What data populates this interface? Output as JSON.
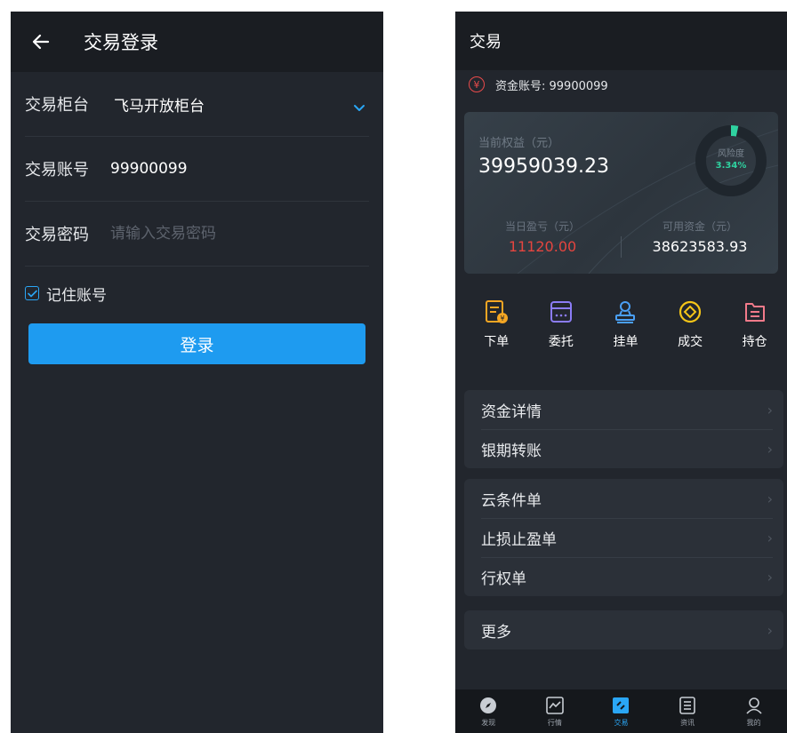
{
  "login_screen": {
    "title": "交易登录",
    "counter": {
      "label": "交易柜台",
      "value": "飞马开放柜台"
    },
    "account": {
      "label": "交易账号",
      "value": "99900099"
    },
    "password": {
      "label": "交易密码",
      "placeholder": "请输入交易密码",
      "value": ""
    },
    "remember": {
      "label": "记住账号",
      "checked": true
    },
    "login_button": "登录"
  },
  "trade_screen": {
    "title": "交易",
    "account_line": "资金账号: 99900099",
    "account_icon_glyph": "¥",
    "equity": {
      "label": "当前权益（元）",
      "value": "39959039.23"
    },
    "risk": {
      "label": "风险度",
      "value": "3.34%",
      "percent": 3.34
    },
    "daily_pnl": {
      "label": "当日盈亏（元）",
      "value": "11120.00"
    },
    "available": {
      "label": "可用资金（元）",
      "value": "38623583.93"
    },
    "actions": [
      {
        "label": "下单",
        "icon": "order-icon"
      },
      {
        "label": "委托",
        "icon": "entrust-icon"
      },
      {
        "label": "挂单",
        "icon": "pending-order-icon"
      },
      {
        "label": "成交",
        "icon": "deal-icon"
      },
      {
        "label": "持仓",
        "icon": "position-icon"
      }
    ],
    "menu_groups": [
      [
        "资金详情",
        "银期转账"
      ],
      [
        "云条件单",
        "止损止盈单",
        "行权单"
      ],
      [
        "更多"
      ]
    ],
    "tabs": [
      {
        "label": "发现",
        "icon": "compass-icon"
      },
      {
        "label": "行情",
        "icon": "chart-icon"
      },
      {
        "label": "交易",
        "icon": "trade-icon",
        "active": true
      },
      {
        "label": "资讯",
        "icon": "news-icon"
      },
      {
        "label": "我的",
        "icon": "profile-icon"
      }
    ]
  },
  "colors": {
    "accent": "#1e9bf0",
    "background": "#22262d",
    "header": "#1a1d22",
    "loss_red": "#e5453f",
    "risk_green": "#2fd2a0",
    "icon_orange": "#f5a623",
    "icon_purple": "#8b7cf6",
    "icon_blue": "#4a9ff5",
    "icon_yellow": "#f5c518",
    "icon_pink": "#f27a8a"
  }
}
